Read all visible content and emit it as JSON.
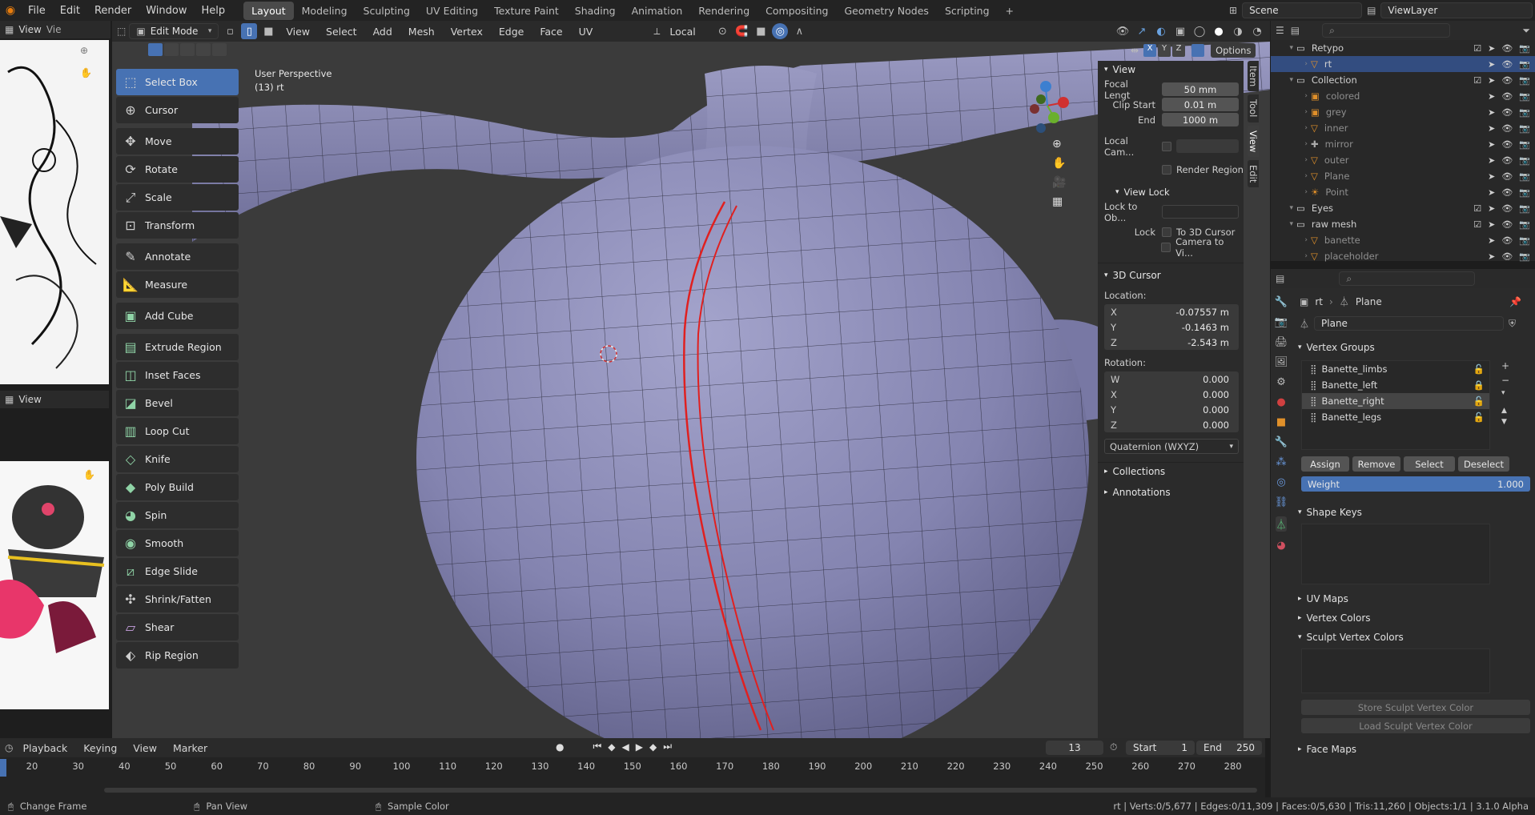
{
  "topbar": {
    "menus": [
      "File",
      "Edit",
      "Render",
      "Window",
      "Help"
    ],
    "workspaces": [
      "Layout",
      "Modeling",
      "Sculpting",
      "UV Editing",
      "Texture Paint",
      "Shading",
      "Animation",
      "Rendering",
      "Compositing",
      "Geometry Nodes",
      "Scripting"
    ],
    "active_workspace": "Layout",
    "scene": "Scene",
    "view_layer": "ViewLayer"
  },
  "left_pane": {
    "view_label_top": "View",
    "view_label_bottom": "View",
    "vie_label": "Vie"
  },
  "viewport_header": {
    "mode": "Edit Mode",
    "menus": [
      "View",
      "Select",
      "Add",
      "Mesh",
      "Vertex",
      "Edge",
      "Face",
      "UV"
    ],
    "transform_orientation": "Local",
    "axes": [
      "X",
      "Y",
      "Z"
    ],
    "options_label": "Options"
  },
  "viewport": {
    "perspective_label": "User Perspective",
    "object_label": "(13) rt"
  },
  "tools": [
    {
      "label": "Select Box",
      "icon": "select-box-icon",
      "active": true
    },
    {
      "label": "Cursor",
      "icon": "cursor-icon"
    },
    {
      "label": "Move",
      "icon": "move-icon"
    },
    {
      "label": "Rotate",
      "icon": "rotate-icon"
    },
    {
      "label": "Scale",
      "icon": "scale-icon"
    },
    {
      "label": "Transform",
      "icon": "transform-icon"
    },
    {
      "label": "Annotate",
      "icon": "annotate-icon"
    },
    {
      "label": "Measure",
      "icon": "measure-icon"
    },
    {
      "label": "Add Cube",
      "icon": "add-cube-icon"
    },
    {
      "label": "Extrude Region",
      "icon": "extrude-icon"
    },
    {
      "label": "Inset Faces",
      "icon": "inset-icon"
    },
    {
      "label": "Bevel",
      "icon": "bevel-icon"
    },
    {
      "label": "Loop Cut",
      "icon": "loop-cut-icon"
    },
    {
      "label": "Knife",
      "icon": "knife-icon"
    },
    {
      "label": "Poly Build",
      "icon": "poly-build-icon"
    },
    {
      "label": "Spin",
      "icon": "spin-icon"
    },
    {
      "label": "Smooth",
      "icon": "smooth-icon"
    },
    {
      "label": "Edge Slide",
      "icon": "edge-slide-icon"
    },
    {
      "label": "Shrink/Fatten",
      "icon": "shrink-fatten-icon"
    },
    {
      "label": "Shear",
      "icon": "shear-icon"
    },
    {
      "label": "Rip Region",
      "icon": "rip-region-icon"
    }
  ],
  "npanel": {
    "tabs": [
      "Item",
      "Tool",
      "View",
      "Edit"
    ],
    "active_tab": "View",
    "view_header": "View",
    "focal_label": "Focal Lengt",
    "focal_value": "50 mm",
    "clip_start_label": "Clip Start",
    "clip_start_value": "0.01 m",
    "end_label": "End",
    "end_value": "1000 m",
    "local_cam_label": "Local Cam...",
    "render_region_label": "Render Region",
    "view_lock_header": "View Lock",
    "lock_to_obj_label": "Lock to Ob...",
    "lock_label": "Lock",
    "to_3d_cursor_label": "To 3D Cursor",
    "camera_to_view_label": "Camera to Vi...",
    "cursor_header": "3D Cursor",
    "location_label": "Location:",
    "loc_x_label": "X",
    "loc_x": "-0.07557 m",
    "loc_y_label": "Y",
    "loc_y": "-0.1463 m",
    "loc_z_label": "Z",
    "loc_z": "-2.543 m",
    "rotation_label": "Rotation:",
    "rot_w_label": "W",
    "rot_w": "0.000",
    "rot_x_label": "X",
    "rot_x": "0.000",
    "rot_y_label": "Y",
    "rot_y": "0.000",
    "rot_z_label": "Z",
    "rot_z": "0.000",
    "rotation_mode": "Quaternion (WXYZ)",
    "collections_label": "Collections",
    "annotations_label": "Annotations"
  },
  "outliner": {
    "rows": [
      {
        "name": "Retypo",
        "indent": 1,
        "type": "collection"
      },
      {
        "name": "rt",
        "indent": 2,
        "type": "mesh",
        "selected": true
      },
      {
        "name": "Collection",
        "indent": 1,
        "type": "collection"
      },
      {
        "name": "colored",
        "indent": 2,
        "type": "image",
        "dim": true
      },
      {
        "name": "grey",
        "indent": 2,
        "type": "image",
        "dim": true
      },
      {
        "name": "inner",
        "indent": 2,
        "type": "mesh",
        "dim": true
      },
      {
        "name": "mirror",
        "indent": 2,
        "type": "empty",
        "dim": true
      },
      {
        "name": "outer",
        "indent": 2,
        "type": "mesh",
        "dim": true
      },
      {
        "name": "Plane",
        "indent": 2,
        "type": "mesh",
        "dim": true
      },
      {
        "name": "Point",
        "indent": 2,
        "type": "light",
        "dim": true
      },
      {
        "name": "Eyes",
        "indent": 1,
        "type": "collection"
      },
      {
        "name": "raw mesh",
        "indent": 1,
        "type": "collection"
      },
      {
        "name": "banette",
        "indent": 2,
        "type": "mesh",
        "dim": true
      },
      {
        "name": "placeholder",
        "indent": 2,
        "type": "mesh",
        "dim": true
      }
    ]
  },
  "properties": {
    "breadcrumb_obj": "rt",
    "breadcrumb_data": "Plane",
    "data_name": "Plane",
    "vertex_groups_header": "Vertex Groups",
    "vertex_groups": [
      "Banette_limbs",
      "Banette_left",
      "Banette_right",
      "Banette_legs"
    ],
    "active_group": "Banette_right",
    "assign_label": "Assign",
    "remove_label": "Remove",
    "select_label": "Select",
    "deselect_label": "Deselect",
    "weight_label": "Weight",
    "weight_value": "1.000",
    "shape_keys_header": "Shape Keys",
    "uv_maps_header": "UV Maps",
    "vertex_colors_header": "Vertex Colors",
    "sculpt_vertex_colors_header": "Sculpt Vertex Colors",
    "store_svc_label": "Store Sculpt Vertex Color",
    "load_svc_label": "Load Sculpt Vertex Color",
    "face_maps_header": "Face Maps"
  },
  "timeline": {
    "menus": [
      "Playback",
      "Keying",
      "View",
      "Marker"
    ],
    "current_frame": "13",
    "start_label": "Start",
    "start_value": "1",
    "end_label": "End",
    "end_value": "250",
    "ticks": [
      "20",
      "30",
      "40",
      "50",
      "60",
      "70",
      "80",
      "90",
      "100",
      "110",
      "120",
      "130",
      "140",
      "150",
      "160",
      "170",
      "180",
      "190",
      "200",
      "210",
      "220",
      "230",
      "240",
      "250",
      "260",
      "270",
      "280"
    ]
  },
  "statusbar": {
    "change_frame": "Change Frame",
    "pan_view": "Pan View",
    "sample_color": "Sample Color",
    "stats": "rt | Verts:0/5,677 | Edges:0/11,309 | Faces:0/5,630 | Tris:11,260 | Objects:1/1 | 3.1.0 Alpha"
  },
  "colors": {
    "accent": "#4772b3",
    "mesh": "#8080aa",
    "seam": "#e02020"
  }
}
